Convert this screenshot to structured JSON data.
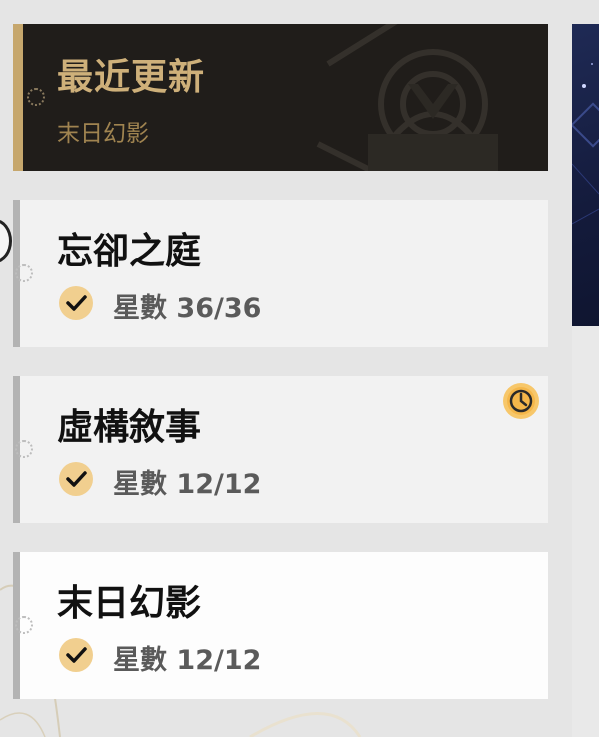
{
  "header": {
    "title": "最近更新",
    "subtitle": "末日幻影"
  },
  "levels": [
    {
      "title": "忘卻之庭",
      "stars_label": "星數",
      "stars": "36/36",
      "completed": true,
      "timed": false,
      "selected": false
    },
    {
      "title": "虛構敘事",
      "stars_label": "星數",
      "stars": "12/12",
      "completed": true,
      "timed": true,
      "selected": false
    },
    {
      "title": "末日幻影",
      "stars_label": "星數",
      "stars": "12/12",
      "completed": true,
      "timed": false,
      "selected": true
    }
  ],
  "icons": {
    "check": "check-icon",
    "timer": "clock-icon"
  },
  "colors": {
    "accent_gold": "#c6a76d",
    "check_bg": "#f1cf8f",
    "timer_bg": "#f5b74a",
    "header_bg": "#201d1a"
  }
}
